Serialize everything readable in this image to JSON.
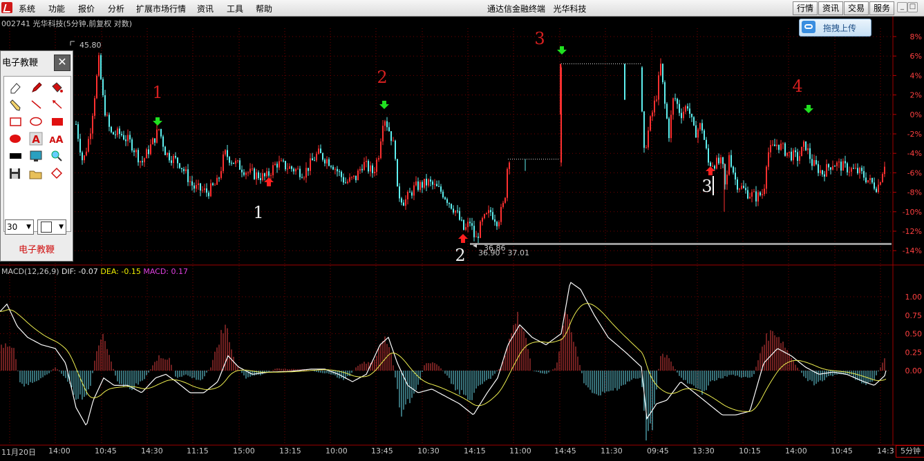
{
  "menubar": {
    "items": [
      "系统",
      "功能",
      "报价",
      "分析",
      "扩展市场行情",
      "资讯",
      "工具",
      "帮助"
    ],
    "app_title": "通达信金融终端",
    "stock_name": "光华科技",
    "right_buttons": [
      "行情",
      "资讯",
      "交易",
      "服务"
    ]
  },
  "chart": {
    "header": "002741 光华科技(5分钟,前复权 对数)",
    "high_label": "45.80",
    "low_label": "36.86",
    "range_label": "36.90 - 37.01",
    "price_axis": [
      "8%",
      "6%",
      "4%",
      "2%",
      "0%",
      "-2%",
      "-4%",
      "-6%",
      "-8%",
      "-10%",
      "-12%",
      "-14%"
    ],
    "sell_markers": [
      "1",
      "2",
      "3",
      "4"
    ],
    "buy_markers": [
      "1",
      "2",
      "3"
    ],
    "colors": {
      "up": "#ff3030",
      "down": "#5ff0f0",
      "sell": "#20e020",
      "buy": "#ff2020",
      "grid": "#7a0000"
    }
  },
  "macd": {
    "name": "MACD(12,26,9)",
    "dif_label": "DIF: -0.07",
    "dea_label": "DEA: -0.15",
    "macd_label": "MACD: 0.17",
    "axis": [
      "1.00",
      "0.75",
      "0.50",
      "0.25",
      "0.00"
    ]
  },
  "time_axis": [
    "11月20日",
    "14:00",
    "10:45",
    "14:30",
    "11:15",
    "15:00",
    "13:15",
    "10:00",
    "13:45",
    "10:30",
    "14:15",
    "11:00",
    "14:45",
    "11:30",
    "09:45",
    "13:30",
    "10:15",
    "14:00",
    "10:45",
    "14:3"
  ],
  "period": "5分钟",
  "upload_button": "拖拽上传",
  "pen_panel": {
    "title": "电子教鞭",
    "footer": "电子教鞭",
    "line_width": "30",
    "tools": [
      "eraser-icon",
      "pen-icon",
      "paint-bucket-icon",
      "pencil-icon",
      "line-icon",
      "arrow-icon",
      "rectangle-outline-icon",
      "ellipse-outline-icon",
      "rectangle-fill-icon",
      "ellipse-fill-icon",
      "text-icon",
      "text-size-icon",
      "color-block-icon",
      "screen-icon",
      "zoom-icon",
      "save-icon",
      "open-icon",
      "diamond-icon"
    ]
  }
}
